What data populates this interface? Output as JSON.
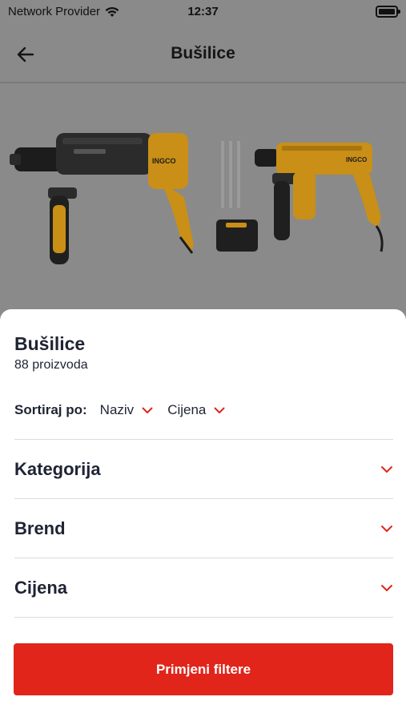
{
  "status_bar": {
    "carrier": "Network Provider",
    "time": "12:37"
  },
  "header": {
    "title": "Bušilice"
  },
  "sheet": {
    "title": "Bušilice",
    "product_count": "88 proizvoda",
    "sort": {
      "label": "Sortiraj po:",
      "options": [
        "Naziv",
        "Cijena"
      ]
    },
    "filters": [
      "Kategorija",
      "Brend",
      "Cijena"
    ],
    "apply_label": "Primjeni filtere"
  },
  "product": {
    "brand_label": "INGCO"
  },
  "colors": {
    "accent": "#e1251b",
    "tool_yellow": "#e8a818"
  }
}
